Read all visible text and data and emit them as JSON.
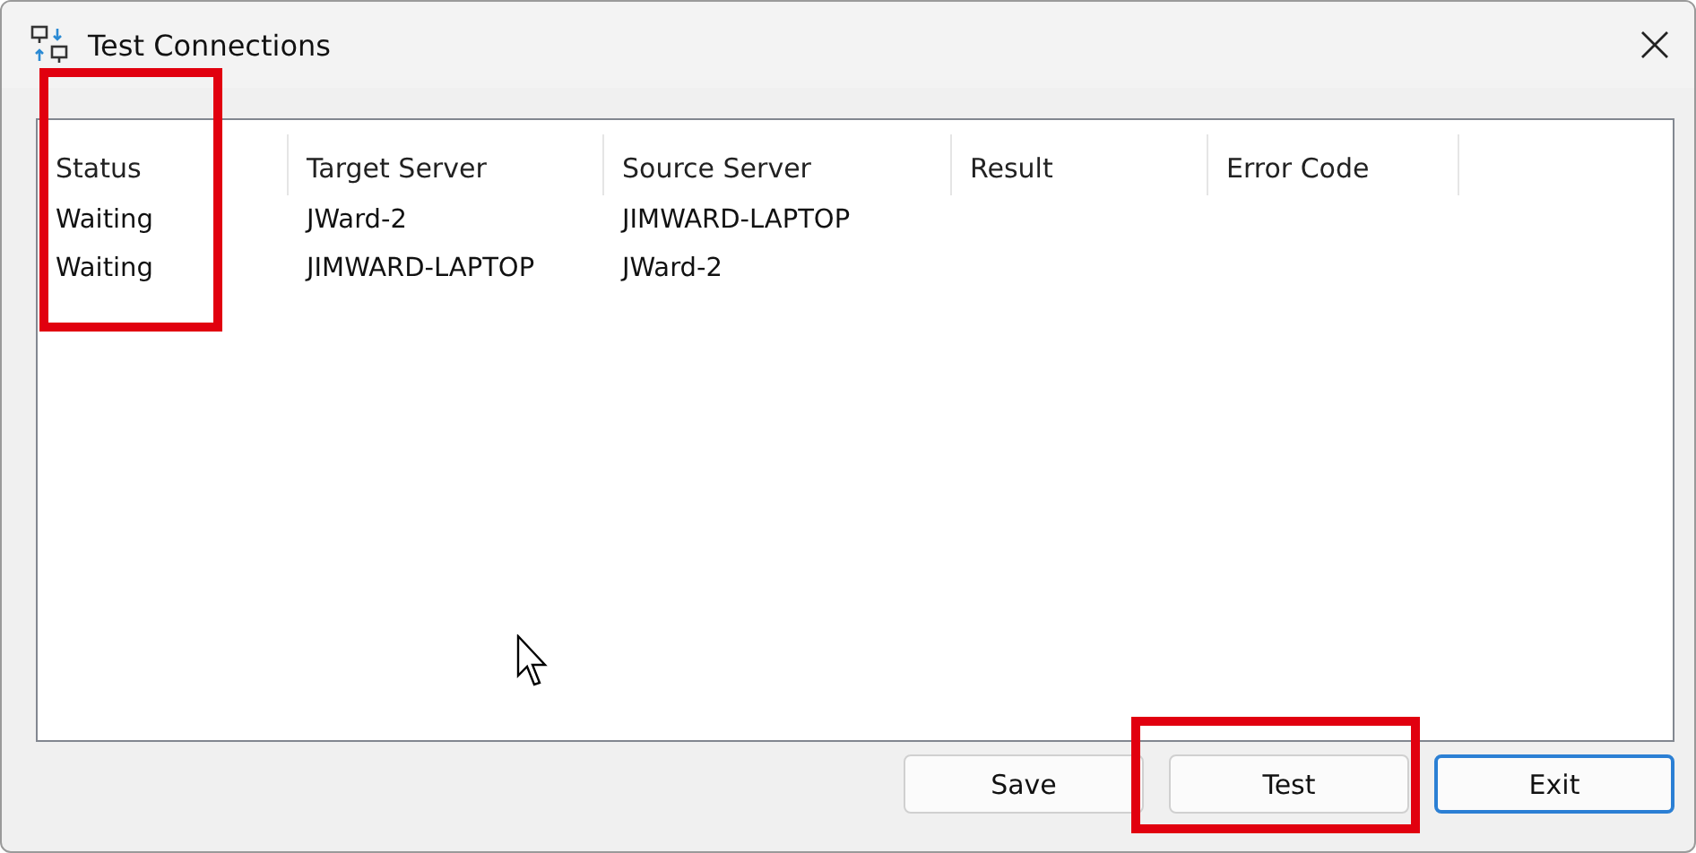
{
  "window": {
    "title": "Test Connections"
  },
  "table": {
    "columns": [
      "Status",
      "Target Server",
      "Source Server",
      "Result",
      "Error Code"
    ],
    "rows": [
      [
        "Waiting",
        "JWard-2",
        "JIMWARD-LAPTOP",
        "",
        ""
      ],
      [
        "Waiting",
        "JIMWARD-LAPTOP",
        "JWard-2",
        "",
        ""
      ]
    ]
  },
  "buttons": [
    {
      "label": "Save",
      "focused": false
    },
    {
      "label": "Test",
      "focused": false
    },
    {
      "label": "Exit",
      "focused": true
    }
  ]
}
